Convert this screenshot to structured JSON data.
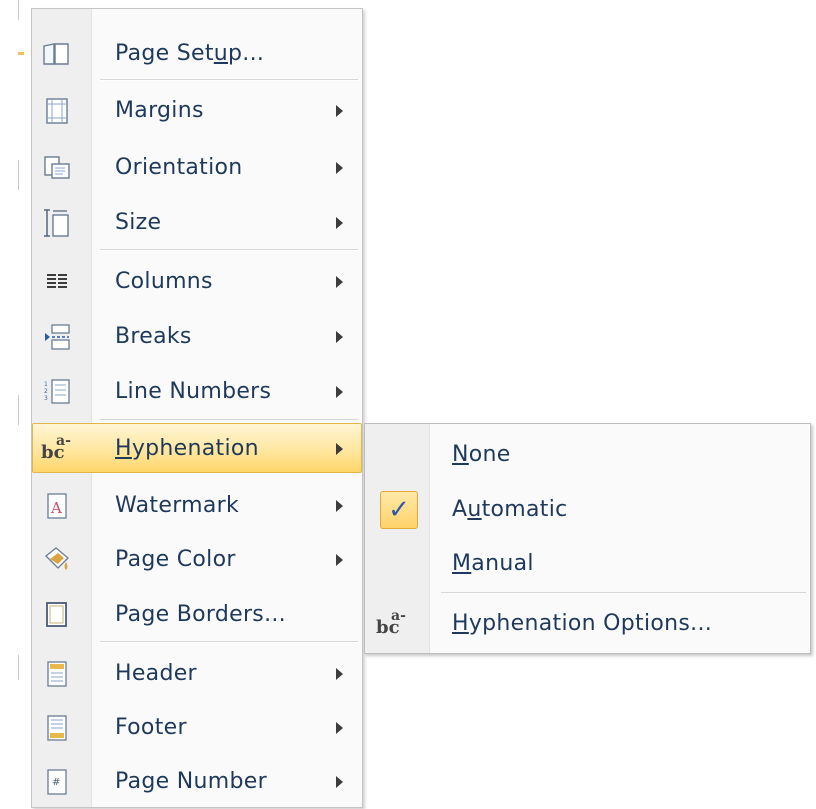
{
  "menu": {
    "items": [
      {
        "label_before": "Page Set",
        "label_ul": "u",
        "label_after": "p...",
        "icon": "page-setup-icon",
        "submenu": false
      },
      {
        "label": "Margins",
        "icon": "margins-icon",
        "submenu": true
      },
      {
        "label": "Orientation",
        "icon": "orientation-icon",
        "submenu": true
      },
      {
        "label": "Size",
        "icon": "size-icon",
        "submenu": true
      },
      {
        "label": "Columns",
        "icon": "columns-icon",
        "submenu": true
      },
      {
        "label": "Breaks",
        "icon": "breaks-icon",
        "submenu": true
      },
      {
        "label": "Line Numbers",
        "icon": "line-numbers-icon",
        "submenu": true
      },
      {
        "label_ul": "H",
        "label_after": "yphenation",
        "icon": "hyphenation-icon",
        "submenu": true,
        "highlighted": true
      },
      {
        "label": "Watermark",
        "icon": "watermark-icon",
        "submenu": true
      },
      {
        "label": "Page Color",
        "icon": "page-color-icon",
        "submenu": true
      },
      {
        "label": "Page Borders...",
        "icon": "page-borders-icon",
        "submenu": false
      },
      {
        "label": "Header",
        "icon": "header-icon",
        "submenu": true
      },
      {
        "label": "Footer",
        "icon": "footer-icon",
        "submenu": true
      },
      {
        "label": "Page Number",
        "icon": "page-number-icon",
        "submenu": true
      }
    ]
  },
  "submenu": {
    "items": [
      {
        "label_ul": "N",
        "label_after": "one",
        "checked": false
      },
      {
        "label_before": "A",
        "label_ul": "u",
        "label_after": "tomatic",
        "checked": true
      },
      {
        "label_ul": "M",
        "label_after": "anual",
        "checked": false
      },
      {
        "label_ul": "H",
        "label_after": "yphenation Options...",
        "icon": "hyphenation-options-icon"
      }
    ],
    "check_glyph": "✓"
  },
  "icon_glyphs": {
    "hyph_b": "bc",
    "hyph_a": "a-"
  },
  "colors": {
    "highlight": "#ffd569",
    "text": "#1e395b",
    "check": "#2b5aa8"
  }
}
